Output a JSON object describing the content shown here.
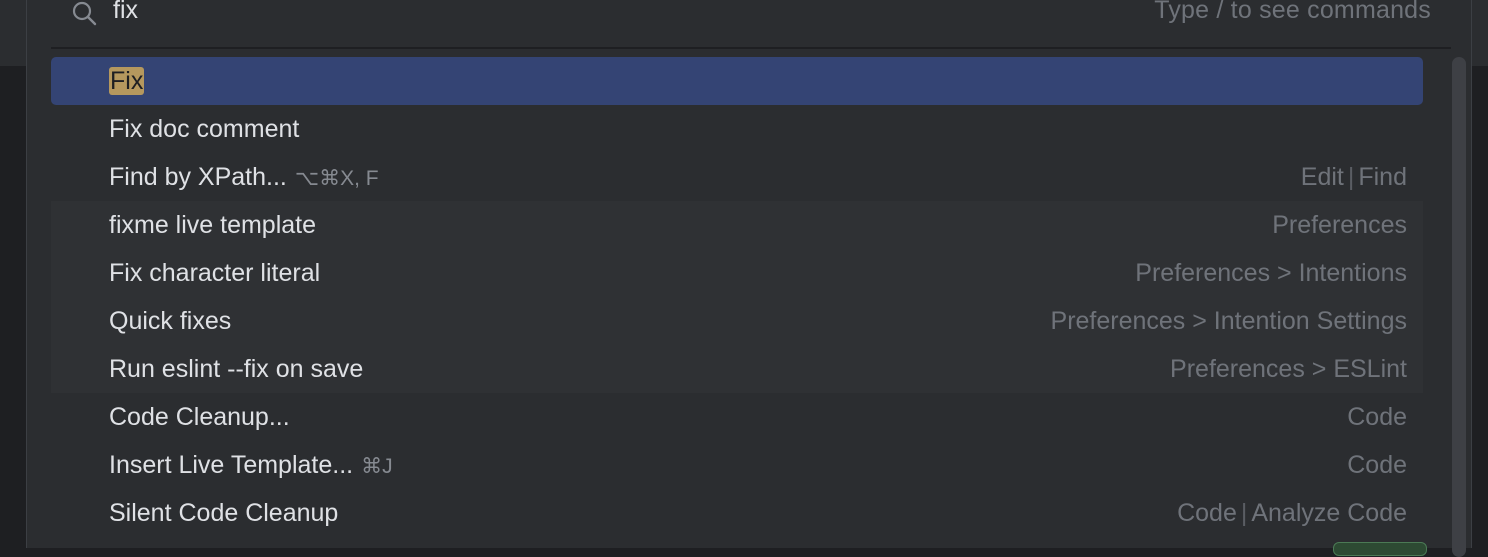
{
  "search": {
    "value": "fix",
    "hint": "Type / to see commands",
    "icon": "search-icon"
  },
  "results": [
    {
      "pre": "",
      "match": "Fix",
      "post": "",
      "shortcut": "",
      "location": [],
      "selected": true
    },
    {
      "pre": "",
      "match": "",
      "post": "Fix doc comment",
      "shortcut": "",
      "location": []
    },
    {
      "pre": "",
      "match": "",
      "post": "Find by XPath...",
      "shortcut": "⌥⌘X, F",
      "location": [
        "Edit",
        "Find"
      ]
    },
    {
      "pre": "",
      "match": "",
      "post": "fixme live template",
      "shortcut": "",
      "location": [
        "Preferences"
      ],
      "shaded": true
    },
    {
      "pre": "",
      "match": "",
      "post": "Fix character literal",
      "shortcut": "",
      "location": [
        "Preferences > Intentions"
      ],
      "shaded": true
    },
    {
      "pre": "",
      "match": "",
      "post": "Quick fixes",
      "shortcut": "",
      "location": [
        "Preferences > Intention Settings"
      ],
      "shaded": true
    },
    {
      "pre": "",
      "match": "",
      "post": "Run eslint --fix on save",
      "shortcut": "",
      "location": [
        "Preferences > ESLint"
      ],
      "shaded": true
    },
    {
      "pre": "",
      "match": "",
      "post": "Code Cleanup...",
      "shortcut": "",
      "location": [
        "Code"
      ]
    },
    {
      "pre": "",
      "match": "",
      "post": "Insert Live Template...",
      "shortcut": "⌘J",
      "location": [
        "Code"
      ]
    },
    {
      "pre": "",
      "match": "",
      "post": "Silent Code Cleanup",
      "shortcut": "",
      "location": [
        "Code",
        "Analyze Code"
      ]
    }
  ],
  "colors": {
    "selection": "#344474",
    "highlight": "#b5985e",
    "text": "#dfe1e5",
    "muted": "#6f737a"
  }
}
